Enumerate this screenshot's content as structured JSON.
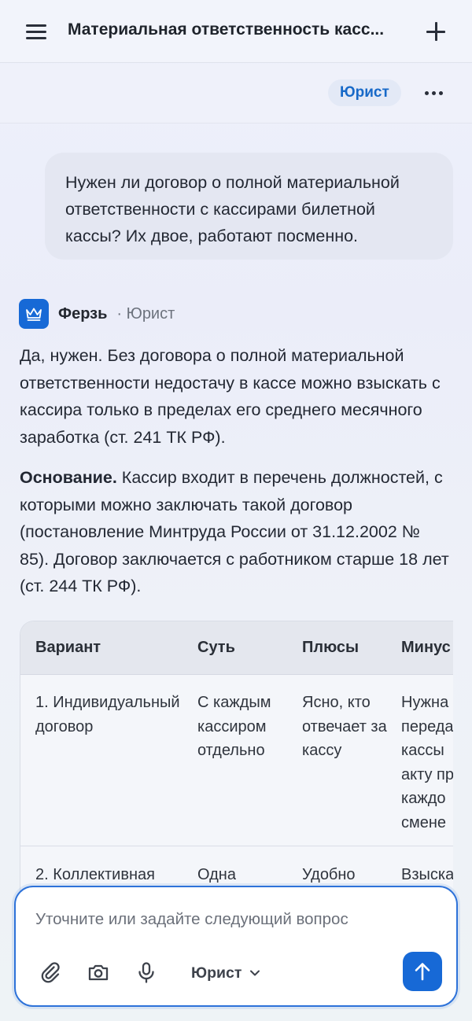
{
  "header": {
    "title": "Материальная ответственность касс...",
    "role_chip": "Юрист"
  },
  "user_message": "Нужен ли договор о полной материальной ответственности с кассирами билетной кассы? Их двое, работают посменно.",
  "assistant": {
    "name": "Ферзь",
    "role": "· Юрист",
    "paragraph1": "Да, нужен. Без договора о полной материальной ответственности недостачу в кассе можно взыскать с кассира только в пределах его среднего месячного заработка (ст. 241 ТК РФ).",
    "paragraph2_lead": "Основание.",
    "paragraph2_text": " Кассир входит в перечень должностей, с которыми можно заключать такой договор (постановление Минтруда России от 31.12.2002 № 85). Договор заключается с работником старше 18 лет (ст. 244 ТК РФ)."
  },
  "table": {
    "headers": [
      "Вариант",
      "Суть",
      "Плюсы",
      "Минус"
    ],
    "rows": [
      [
        "1. Индивидуальный договор",
        "С каждым кассиром отдельно",
        "Ясно, кто отвечает за кассу",
        "Нужна\nпереда\nкассы\nакту пр\nкаждо\nсмене"
      ],
      [
        "2. Коллективная",
        "Одна",
        "Удобно",
        "Взыска"
      ]
    ]
  },
  "composer": {
    "placeholder": "Уточните или задайте следующий вопрос",
    "role_select": "Юрист"
  },
  "icons": {
    "menu": "hamburger-icon",
    "new_chat": "plus-icon",
    "more": "more-dots-icon",
    "avatar": "crown-icon",
    "attach": "paperclip-icon",
    "camera": "camera-icon",
    "mic": "microphone-icon",
    "dropdown": "chevron-down-icon",
    "send": "arrow-up-icon"
  },
  "colors": {
    "accent": "#1769d6",
    "chip_text": "#1769c8",
    "chip_bg": "#e3e9f6"
  }
}
